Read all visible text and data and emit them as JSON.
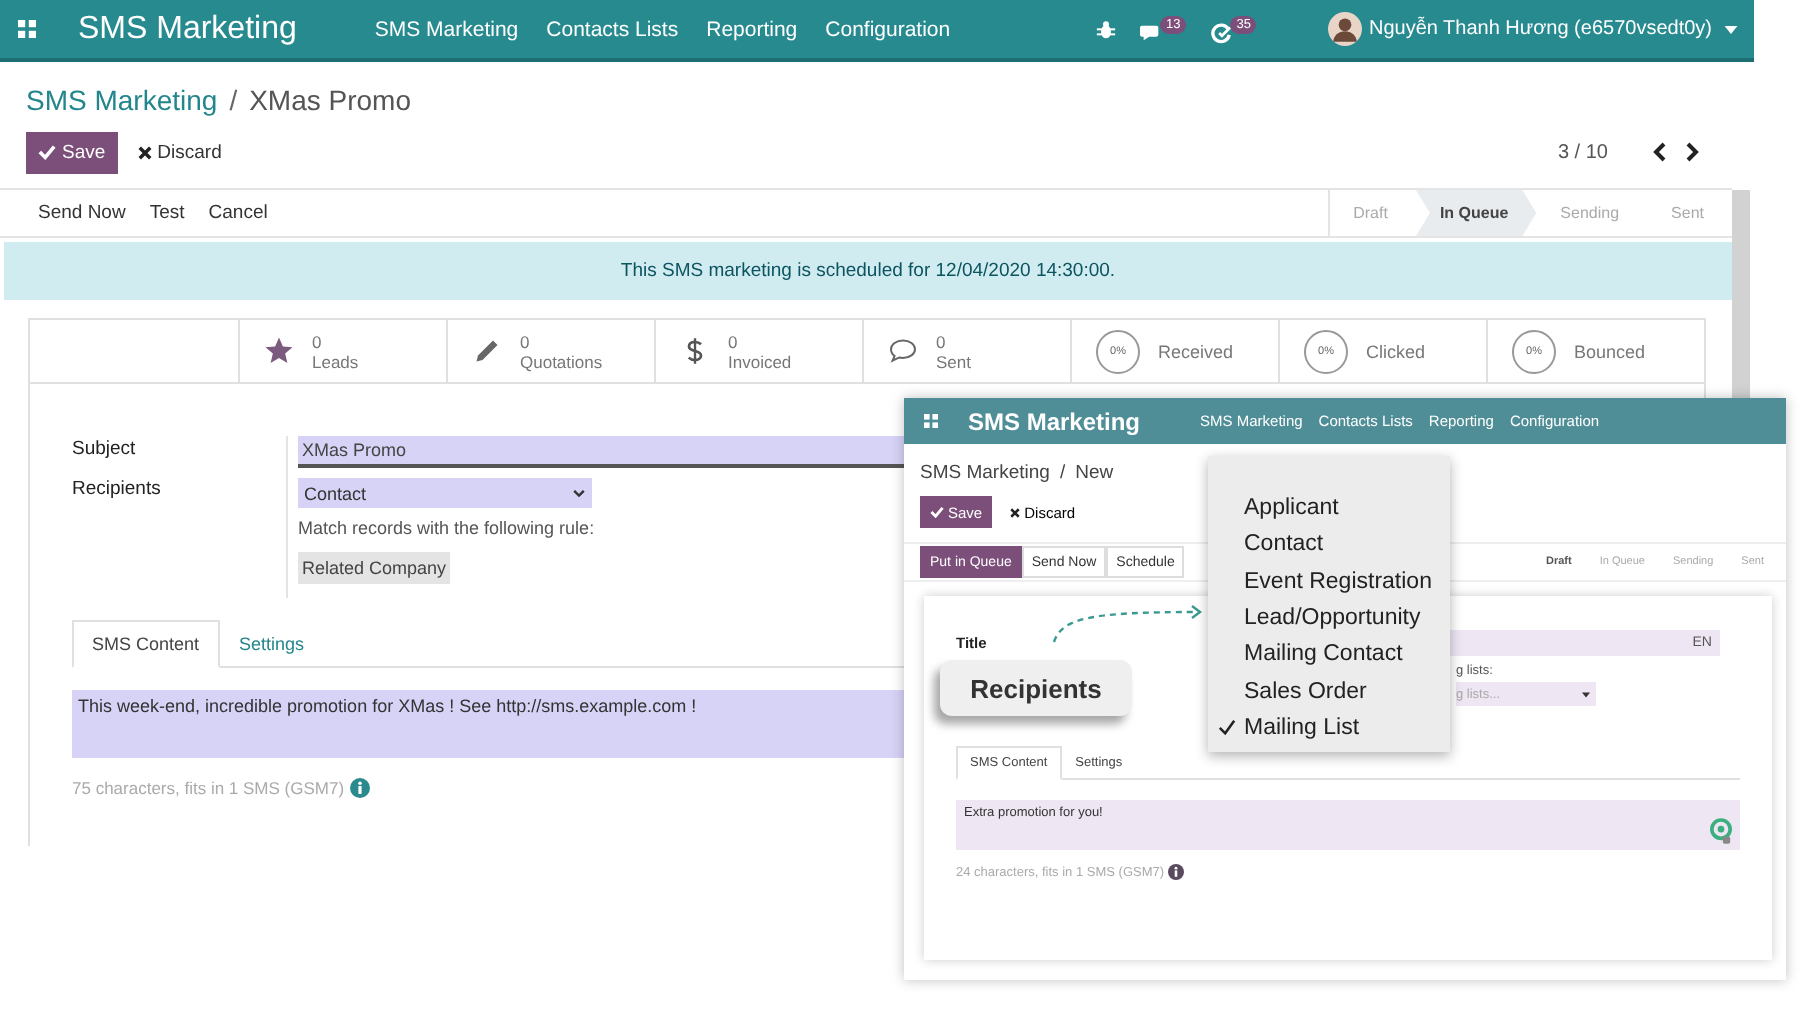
{
  "main": {
    "navbar": {
      "app_name": "SMS Marketing",
      "menu": [
        "SMS Marketing",
        "Contacts Lists",
        "Reporting",
        "Configuration"
      ],
      "messages_count": "13",
      "activities_count": "35",
      "user": "Nguyễn Thanh Hương (e6570vsedt0y)"
    },
    "breadcrumb": [
      {
        "label": "SMS Marketing",
        "kind": "link"
      },
      {
        "label": "XMas Promo",
        "kind": "current"
      }
    ],
    "breadcrumb_separator": "/",
    "buttons": [
      {
        "label": "Save",
        "kind": "primary"
      },
      {
        "label": "Discard",
        "kind": "discard"
      }
    ],
    "pager": "3 / 10",
    "actions": [
      {
        "label": "Send Now",
        "kind": "plain"
      },
      {
        "label": "Test",
        "kind": "plain"
      },
      {
        "label": "Cancel",
        "kind": "plain"
      }
    ],
    "stages": [
      {
        "label": "Draft",
        "selected": false
      },
      {
        "label": "In Queue",
        "selected": true
      },
      {
        "label": "Sending",
        "selected": false
      },
      {
        "label": "Sent",
        "selected": false
      }
    ],
    "alert": "This SMS marketing is scheduled for 12/04/2020 14:30:00.",
    "stats": [
      {
        "kind": "count",
        "value": "0",
        "label": "Leads"
      },
      {
        "kind": "count",
        "value": "0",
        "label": "Quotations"
      },
      {
        "kind": "count",
        "value": "0",
        "label": "Invoiced"
      },
      {
        "kind": "count",
        "value": "0",
        "label": "Sent"
      },
      {
        "kind": "rate",
        "value": "0%",
        "label": "Received"
      },
      {
        "kind": "rate",
        "value": "0%",
        "label": "Clicked"
      },
      {
        "kind": "rate",
        "value": "0%",
        "label": "Bounced"
      }
    ],
    "form": {
      "subject_label": "Subject",
      "subject": "XMas Promo",
      "recipients_label": "Recipients",
      "recipients": "Contact",
      "rule_label": "Match records with the following rule:",
      "rule": "Related Company"
    },
    "tabs": [
      {
        "label": "SMS Content",
        "selected": true
      },
      {
        "label": "Settings",
        "selected": false
      }
    ],
    "message": "This week-end, incredible promotion for XMas ! See http://sms.example.com !",
    "counter": "75 characters, fits in 1 SMS (GSM7)"
  },
  "inset": {
    "navbar": {
      "app_name": "SMS Marketing",
      "menu": [
        "SMS Marketing",
        "Contacts Lists",
        "Reporting",
        "Configuration"
      ]
    },
    "breadcrumb": [
      {
        "label": "SMS Marketing",
        "kind": "current"
      },
      {
        "label": "New",
        "kind": "current"
      }
    ],
    "breadcrumb_separator": "/",
    "buttons": [
      {
        "label": "Save",
        "kind": "primary"
      },
      {
        "label": "Discard",
        "kind": "discard"
      }
    ],
    "actions": [
      {
        "label": "Put in Queue",
        "kind": "primary"
      },
      {
        "label": "Send Now",
        "kind": "plain"
      },
      {
        "label": "Schedule",
        "kind": "plain"
      }
    ],
    "stages": [
      {
        "label": "Draft",
        "selected": true
      },
      {
        "label": "In Queue",
        "selected": false
      },
      {
        "label": "Sending",
        "selected": false
      },
      {
        "label": "Sent",
        "selected": false
      }
    ],
    "title_label": "Title",
    "language": "EN",
    "list_label": "g lists:",
    "list_placeholder": "g lists...",
    "tabs": [
      {
        "label": "SMS Content",
        "selected": true
      },
      {
        "label": "Settings",
        "selected": false
      }
    ],
    "message": "Extra promotion for you!",
    "counter": "24 characters, fits in 1 SMS (GSM7)",
    "callout": "Recipients",
    "dropdown": [
      {
        "label": "Applicant",
        "selected": false
      },
      {
        "label": "Contact",
        "selected": false
      },
      {
        "label": "Event Registration",
        "selected": false
      },
      {
        "label": "Lead/Opportunity",
        "selected": false
      },
      {
        "label": "Mailing Contact",
        "selected": false
      },
      {
        "label": "Sales Order",
        "selected": false
      },
      {
        "label": "Mailing List",
        "selected": true
      }
    ]
  }
}
